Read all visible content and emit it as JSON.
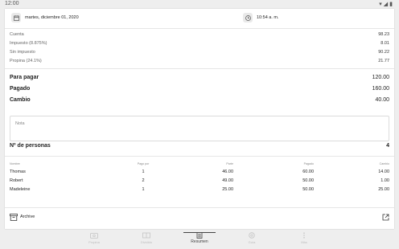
{
  "status": {
    "time": "12:00"
  },
  "datetime": {
    "date": "martes, diciembre 01, 2020",
    "time": "10:54 a. m."
  },
  "summary": [
    {
      "label": "Cuenta",
      "value": "98.23"
    },
    {
      "label": "Impuesto (8.875%)",
      "value": "8.01"
    },
    {
      "label": "Sin impuesto",
      "value": "90.22"
    },
    {
      "label": "Propina (24.1%)",
      "value": "21.77"
    }
  ],
  "totals": [
    {
      "label": "Para pagar",
      "value": "120.00"
    },
    {
      "label": "Pagado",
      "value": "160.00"
    },
    {
      "label": "Cambio",
      "value": "40.00"
    }
  ],
  "note": {
    "placeholder": "Nota"
  },
  "people": {
    "label": "Nº de personas",
    "count": "4"
  },
  "table": {
    "headers": [
      "Nombre",
      "Pago por",
      "Parte",
      "Pagado",
      "Cambio"
    ],
    "rows": [
      [
        "Thomas",
        "1",
        "46.00",
        "60.00",
        "14.00"
      ],
      [
        "Robert",
        "2",
        "49.00",
        "50.00",
        "1.00"
      ],
      [
        "Madeleine",
        "1",
        "25.00",
        "50.00",
        "25.00"
      ]
    ]
  },
  "archive": {
    "label": "Archive"
  },
  "nav": [
    {
      "label": "Propina",
      "icon": "tip-icon"
    },
    {
      "label": "Dividido",
      "icon": "split-icon"
    },
    {
      "label": "Resumen",
      "icon": "summary-icon",
      "active": true
    },
    {
      "label": "Guía",
      "icon": "guide-icon"
    },
    {
      "label": "Más",
      "icon": "more-icon"
    }
  ]
}
